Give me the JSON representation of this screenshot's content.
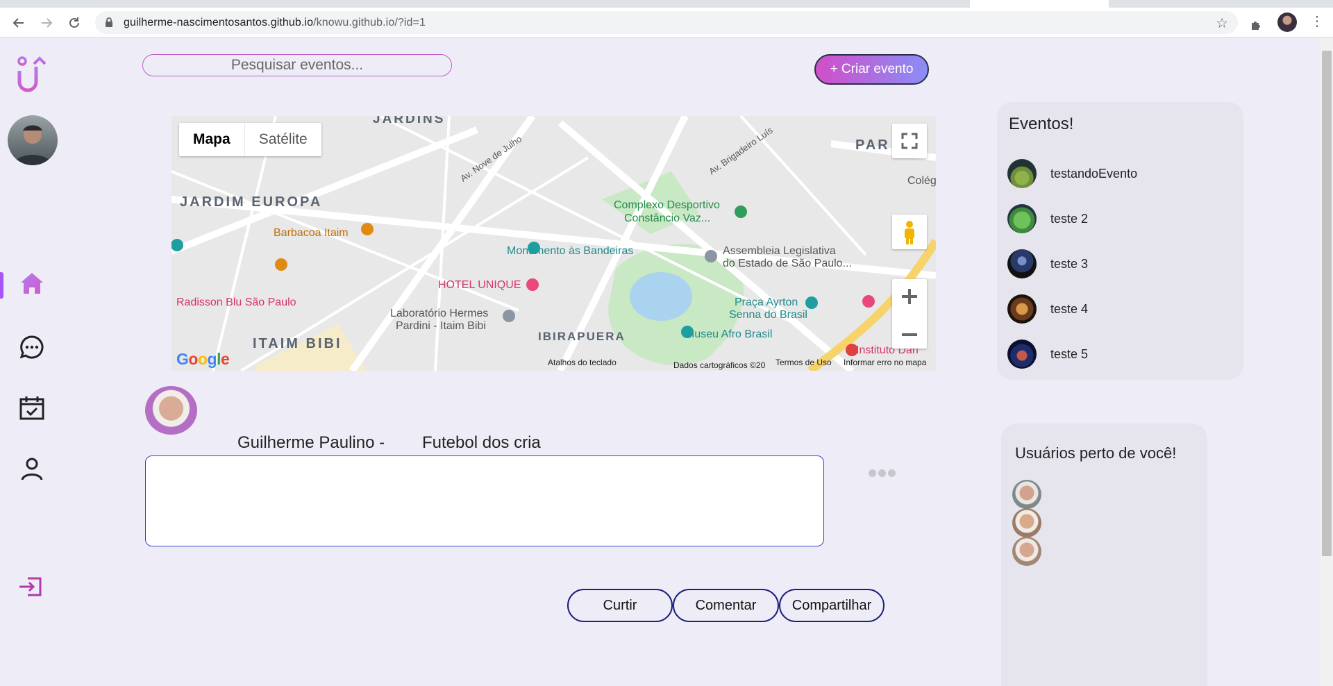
{
  "browser": {
    "url_host": "guilherme-nascimentosantos.github.io",
    "url_path": "/knowu.github.io/?id=1",
    "icons": [
      "back-icon",
      "forward-icon",
      "reload-icon",
      "lock-icon",
      "star-icon",
      "extensions-icon",
      "menu-icon"
    ]
  },
  "sidebar": {
    "items": [
      "home-icon",
      "chat-icon",
      "calendar-icon",
      "profile-icon",
      "logout-icon"
    ],
    "accent": "#a855f7"
  },
  "search": {
    "placeholder": "Pesquisar eventos..."
  },
  "create_event": {
    "label": "+ Criar evento"
  },
  "map": {
    "type_buttons": [
      "Mapa",
      "Satélite"
    ],
    "labels": [
      "JARDINS",
      "JARDIM EUROPA",
      "ITAIM BIBI",
      "IBIRAPUERA",
      "PAR",
      "Barbacoa Itaim",
      "Monumento às Bandeiras",
      "Complexo Desportivo",
      "Constâncio Vaz...",
      "Assembleia Legislativa",
      "do Estado de São Paulo...",
      "HOTEL UNIQUE",
      "Radisson Blu São Paulo",
      "Laboratório Hermes",
      "Pardini - Itaim Bibi",
      "Praça Ayrton",
      "Senna do Brasil",
      "Museu Afro Brasil",
      "Instituto Dan",
      "Av. Nove de Julho",
      "Av. Brigadeiro Luís",
      "Colég"
    ],
    "footer": {
      "shortcuts": "Atalhos do teclado",
      "mapdata": "Dados cartográficos ©20",
      "terms": "Termos de Uso",
      "report": "Informar erro no mapa"
    },
    "logo": "Google"
  },
  "post": {
    "author": "Guilherme Paulino -",
    "event": "Futebol dos cria",
    "actions": [
      "Curtir",
      "Comentar",
      "Compartilhar"
    ]
  },
  "events_panel": {
    "title": "Eventos!",
    "items": [
      {
        "name": "testandoEvento",
        "color": "#6f8f3a"
      },
      {
        "name": "teste 2",
        "color": "#3f8a3c"
      },
      {
        "name": "teste 3",
        "color": "#283a6a"
      },
      {
        "name": "teste 4",
        "color": "#6b3b1e"
      },
      {
        "name": "teste 5",
        "color": "#1f2c6b"
      }
    ]
  },
  "near_panel": {
    "title": "Usuários perto de você!"
  }
}
